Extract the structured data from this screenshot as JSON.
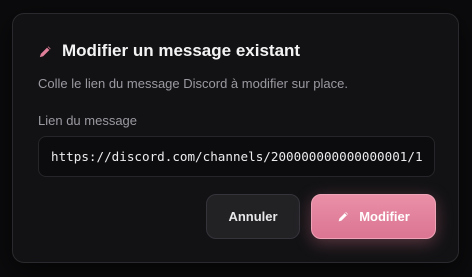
{
  "dialog": {
    "title": "Modifier un message existant",
    "description": "Colle le lien du message Discord à modifier sur place.",
    "field_label": "Lien du message",
    "link_value": "https://discord.com/channels/200000000000000001/1",
    "cancel_label": "Annuler",
    "confirm_label": "Modifier",
    "title_icon": "pencil-icon",
    "confirm_icon": "pencil-icon"
  },
  "colors": {
    "accent": "#e0809b",
    "dialog_background": "#121214",
    "page_background": "#0b0b0d"
  }
}
